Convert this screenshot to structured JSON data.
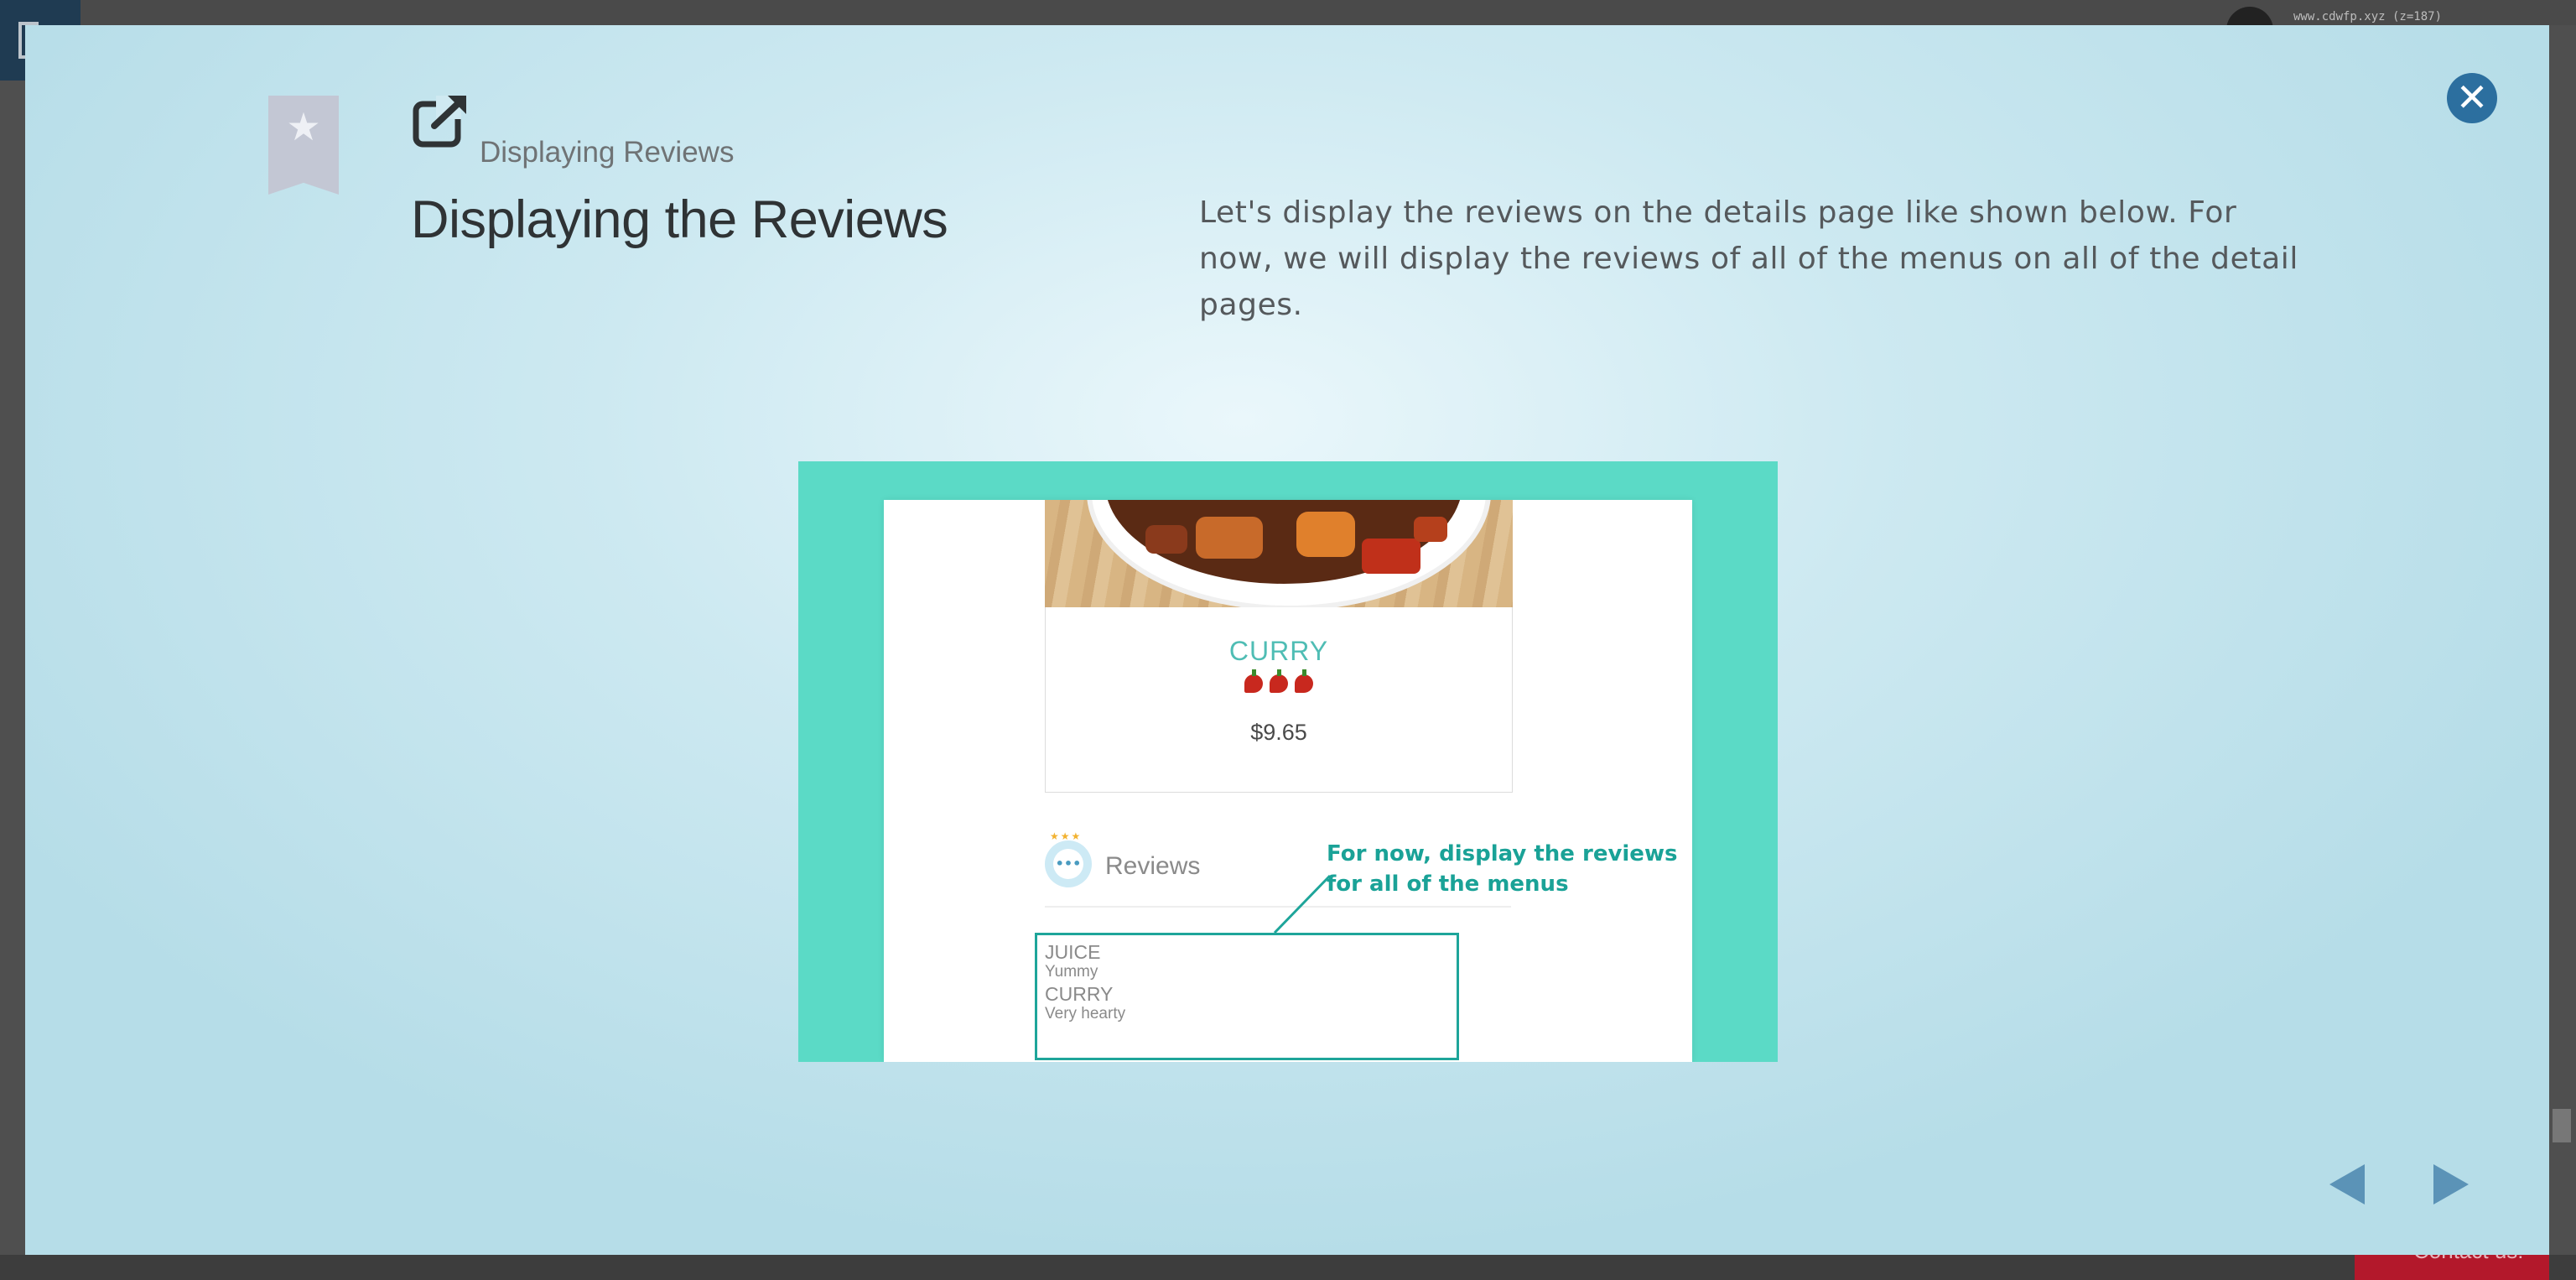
{
  "background": {
    "url_text": "www.cdwfp.xyz (z=187)",
    "contact_label": "Contact us!"
  },
  "modal": {
    "breadcrumb": "Displaying Reviews",
    "title": "Displaying the Reviews",
    "description": "Let's display the reviews on the details page like shown below. For now, we will display the reviews of all of the menus on all of the detail pages.",
    "close_icon": "close-icon",
    "nav": {
      "prev_icon": "triangle-left-icon",
      "next_icon": "triangle-right-icon"
    }
  },
  "illustration": {
    "menu_name": "CURRY",
    "price": "$9.65",
    "spice_level": 3,
    "reviews_title": "Reviews",
    "reviews": [
      {
        "menu": "JUICE",
        "comment": "Yummy"
      },
      {
        "menu": "CURRY",
        "comment": "Very hearty"
      }
    ],
    "annotation_line1": "For now, display the reviews",
    "annotation_line2": "for all of the menus",
    "colors": {
      "frame": "#5bdac6",
      "accent": "#1ea59a",
      "menu_name": "#4fbdb4"
    }
  }
}
